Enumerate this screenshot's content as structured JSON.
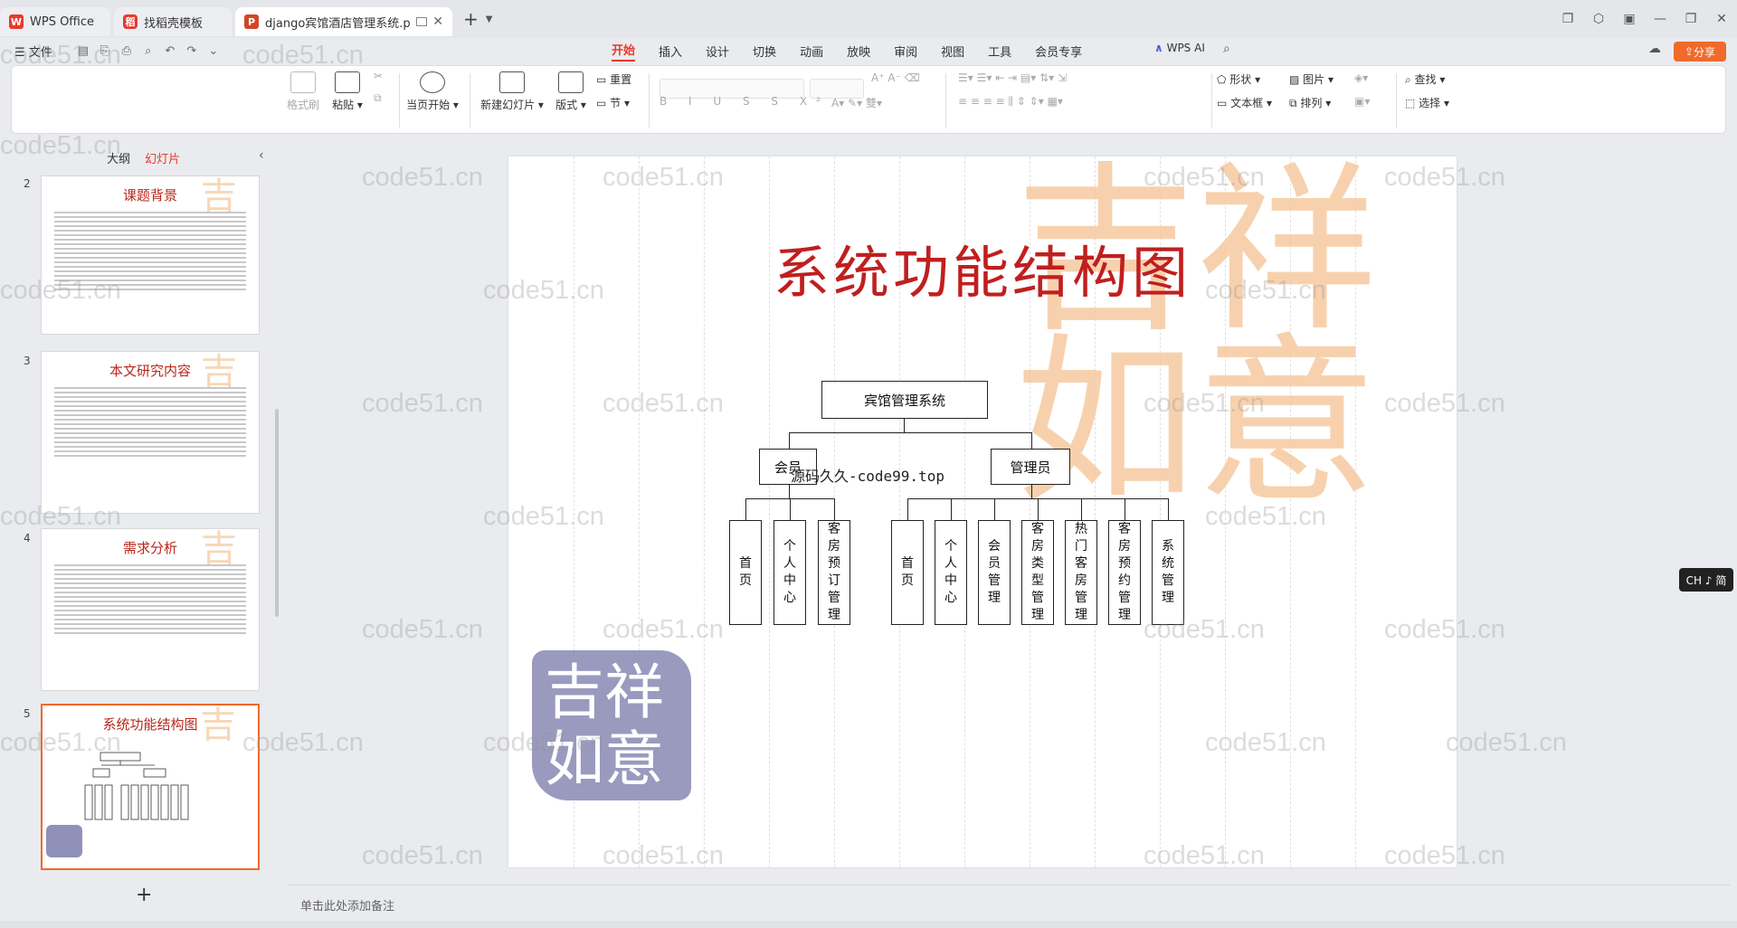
{
  "window": {
    "tabs": [
      {
        "label": "WPS Office",
        "icon": "wps-logo-icon"
      },
      {
        "label": "找稻壳模板",
        "icon": "docer-icon"
      },
      {
        "label": "django宾馆酒店管理系统.pptx",
        "icon": "ppt-file-icon"
      }
    ]
  },
  "menubar": {
    "file_label": "文件",
    "menus": [
      "开始",
      "插入",
      "设计",
      "切换",
      "动画",
      "放映",
      "审阅",
      "视图",
      "工具",
      "会员专享"
    ],
    "active_menu": "开始",
    "wps_ai": "WPS AI",
    "share": "分享"
  },
  "ribbon": {
    "format_painter": "格式刷",
    "paste": "粘贴",
    "start_from_current": "当页开始",
    "new_slide": "新建幻灯片",
    "layout": "版式",
    "reset": "重置",
    "section": "节",
    "shape": "形状",
    "picture": "图片",
    "textbox": "文本框",
    "arrange": "排列",
    "find": "查找",
    "select": "选择"
  },
  "left_pane": {
    "tabs": [
      "大纲",
      "幻灯片"
    ],
    "active_tab": "幻灯片",
    "thumbnails": [
      {
        "number": "2",
        "title": "课题背景"
      },
      {
        "number": "3",
        "title": "本文研究内容"
      },
      {
        "number": "4",
        "title": "需求分析"
      },
      {
        "number": "5",
        "title": "系统功能结构图"
      }
    ]
  },
  "slide": {
    "title": "系统功能结构图",
    "root": "宾馆管理系统",
    "member": "会员",
    "admin": "管理员",
    "overlay": "源码久久-code99.top",
    "member_leaves": [
      "首页",
      "个人中心",
      "客房预订管理"
    ],
    "admin_leaves": [
      "首页",
      "个人中心",
      "会员管理",
      "客房类型管理",
      "热门客房管理",
      "客房预约管理",
      "系统管理"
    ]
  },
  "notes_placeholder": "单击此处添加备注",
  "ime": "CH ♪ 简",
  "watermark": "code51.cn"
}
